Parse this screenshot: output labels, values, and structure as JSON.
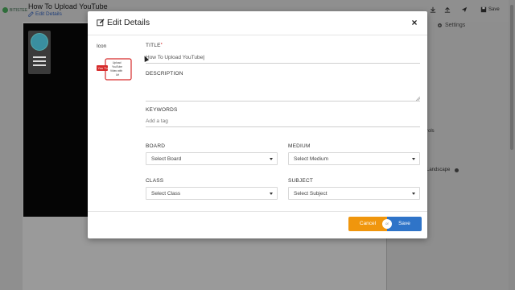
{
  "app": {
    "logo_text": "BITISTEE",
    "title": "How To Upload YouTube",
    "edit_link": "Edit Details",
    "toolbar_save": "Save",
    "settings_tab": "Settings",
    "controls_text": "rols",
    "landscape_text": "Landscape"
  },
  "modal": {
    "title": "Edit Details",
    "icon_label": "Icon",
    "thumbnail_text": [
      "Upload",
      "YouTube",
      "Video with",
      "Url"
    ],
    "thumbnail_badge": "You Tube",
    "title_label": "TITLE",
    "title_required": "*",
    "title_value": "How To Upload YouTube",
    "description_label": "DESCRIPTION",
    "description_value": "",
    "keywords_label": "KEYWORDS",
    "keywords_placeholder": "Add a tag",
    "board_label": "BOARD",
    "board_value": "Select Board",
    "medium_label": "MEDIUM",
    "medium_value": "Select Medium",
    "class_label": "CLASS",
    "class_value": "Select Class",
    "subject_label": "SUBJECT",
    "subject_value": "Select Subject",
    "cancel_label": "Cancel",
    "or_label": "or",
    "save_label": "Save"
  },
  "colors": {
    "cancel": "#f0960d",
    "save": "#2f74c8",
    "youtube_red": "#d62b2b"
  }
}
